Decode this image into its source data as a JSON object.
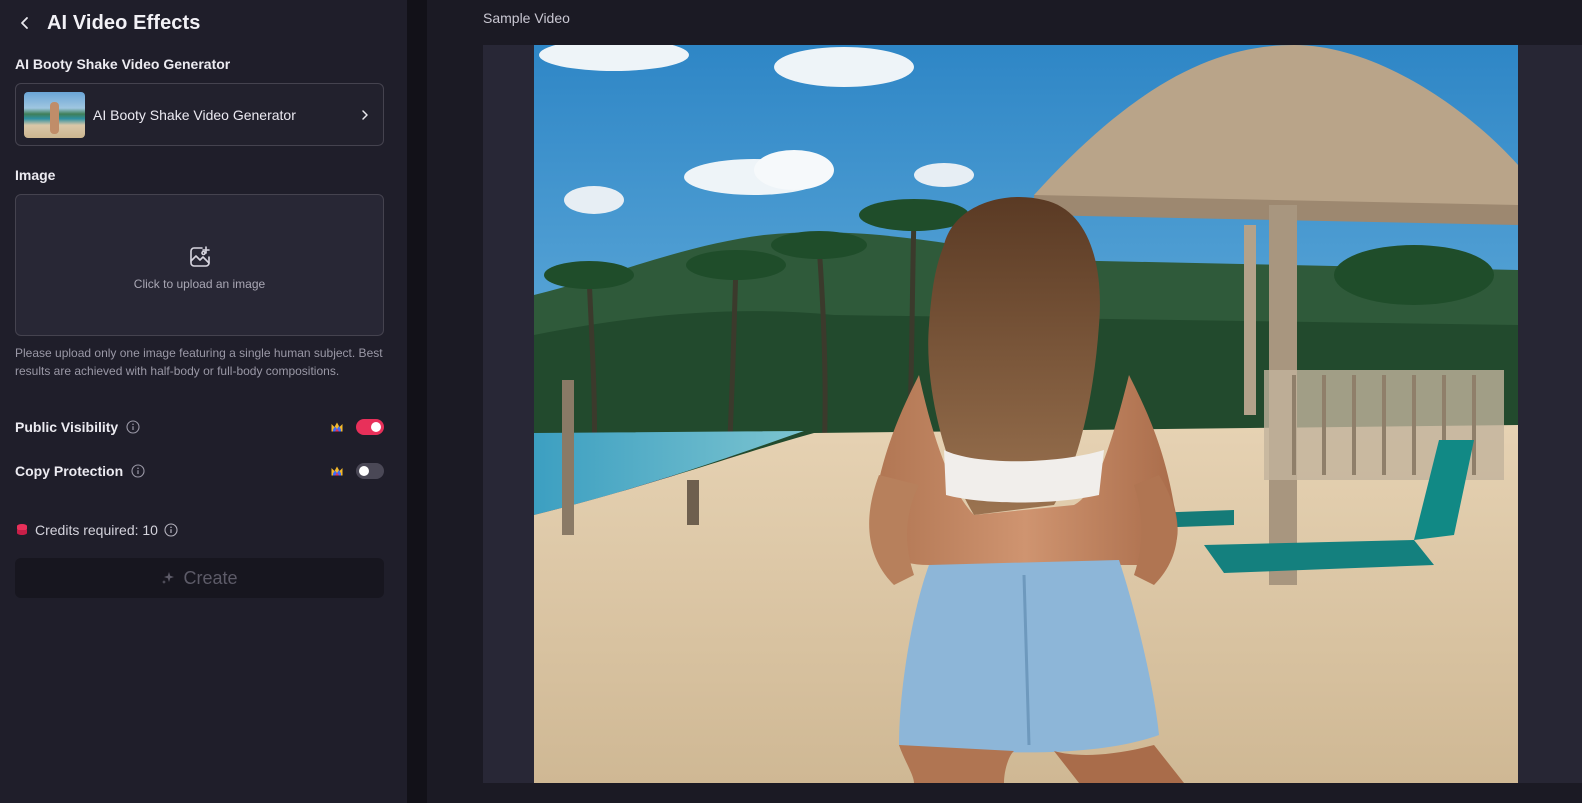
{
  "header": {
    "title": "AI Video Effects",
    "back_icon": "chevron-left-icon"
  },
  "template_section": {
    "label": "AI Booty Shake Video Generator",
    "card_title": "AI Booty Shake Video Generator",
    "arrow_icon": "chevron-right-icon"
  },
  "image_section": {
    "label": "Image",
    "upload_icon": "image-add-icon",
    "upload_text": "Click to upload an image",
    "hint": "Please upload only one image featuring a single human subject. Best results are achieved with half-body or full-body compositions."
  },
  "options": {
    "public_visibility": {
      "label": "Public Visibility",
      "enabled": true
    },
    "copy_protection": {
      "label": "Copy Protection",
      "enabled": false
    }
  },
  "credits": {
    "text": "Credits required: 10"
  },
  "create_button": {
    "label": "Create",
    "disabled": true
  },
  "preview": {
    "title": "Sample Video"
  },
  "colors": {
    "accent": "#e8305a",
    "panel_bg": "#1f1e2a",
    "page_bg": "#1b1a24"
  }
}
